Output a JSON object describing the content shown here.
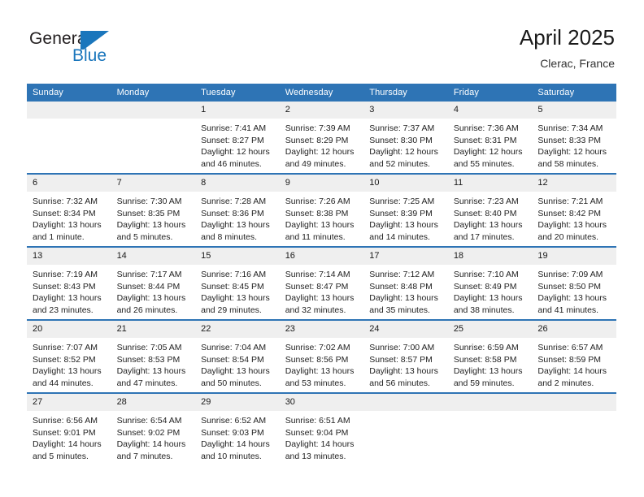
{
  "brand": {
    "name_part1": "General",
    "name_part2": "Blue",
    "logo_icon": "flag-triangle-icon",
    "accent_color": "#1a76bc"
  },
  "header": {
    "title": "April 2025",
    "location": "Clerac, France"
  },
  "theme": {
    "header_blue": "#2e74b5",
    "daynum_background": "#efefef",
    "text_color": "#222222"
  },
  "calendar": {
    "weekday_headers": [
      "Sunday",
      "Monday",
      "Tuesday",
      "Wednesday",
      "Thursday",
      "Friday",
      "Saturday"
    ],
    "weeks": [
      [
        {
          "day": "",
          "blank": true
        },
        {
          "day": "",
          "blank": true
        },
        {
          "day": "1",
          "sunrise": "Sunrise: 7:41 AM",
          "sunset": "Sunset: 8:27 PM",
          "daylight": "Daylight: 12 hours and 46 minutes."
        },
        {
          "day": "2",
          "sunrise": "Sunrise: 7:39 AM",
          "sunset": "Sunset: 8:29 PM",
          "daylight": "Daylight: 12 hours and 49 minutes."
        },
        {
          "day": "3",
          "sunrise": "Sunrise: 7:37 AM",
          "sunset": "Sunset: 8:30 PM",
          "daylight": "Daylight: 12 hours and 52 minutes."
        },
        {
          "day": "4",
          "sunrise": "Sunrise: 7:36 AM",
          "sunset": "Sunset: 8:31 PM",
          "daylight": "Daylight: 12 hours and 55 minutes."
        },
        {
          "day": "5",
          "sunrise": "Sunrise: 7:34 AM",
          "sunset": "Sunset: 8:33 PM",
          "daylight": "Daylight: 12 hours and 58 minutes."
        }
      ],
      [
        {
          "day": "6",
          "sunrise": "Sunrise: 7:32 AM",
          "sunset": "Sunset: 8:34 PM",
          "daylight": "Daylight: 13 hours and 1 minute."
        },
        {
          "day": "7",
          "sunrise": "Sunrise: 7:30 AM",
          "sunset": "Sunset: 8:35 PM",
          "daylight": "Daylight: 13 hours and 5 minutes."
        },
        {
          "day": "8",
          "sunrise": "Sunrise: 7:28 AM",
          "sunset": "Sunset: 8:36 PM",
          "daylight": "Daylight: 13 hours and 8 minutes."
        },
        {
          "day": "9",
          "sunrise": "Sunrise: 7:26 AM",
          "sunset": "Sunset: 8:38 PM",
          "daylight": "Daylight: 13 hours and 11 minutes."
        },
        {
          "day": "10",
          "sunrise": "Sunrise: 7:25 AM",
          "sunset": "Sunset: 8:39 PM",
          "daylight": "Daylight: 13 hours and 14 minutes."
        },
        {
          "day": "11",
          "sunrise": "Sunrise: 7:23 AM",
          "sunset": "Sunset: 8:40 PM",
          "daylight": "Daylight: 13 hours and 17 minutes."
        },
        {
          "day": "12",
          "sunrise": "Sunrise: 7:21 AM",
          "sunset": "Sunset: 8:42 PM",
          "daylight": "Daylight: 13 hours and 20 minutes."
        }
      ],
      [
        {
          "day": "13",
          "sunrise": "Sunrise: 7:19 AM",
          "sunset": "Sunset: 8:43 PM",
          "daylight": "Daylight: 13 hours and 23 minutes."
        },
        {
          "day": "14",
          "sunrise": "Sunrise: 7:17 AM",
          "sunset": "Sunset: 8:44 PM",
          "daylight": "Daylight: 13 hours and 26 minutes."
        },
        {
          "day": "15",
          "sunrise": "Sunrise: 7:16 AM",
          "sunset": "Sunset: 8:45 PM",
          "daylight": "Daylight: 13 hours and 29 minutes."
        },
        {
          "day": "16",
          "sunrise": "Sunrise: 7:14 AM",
          "sunset": "Sunset: 8:47 PM",
          "daylight": "Daylight: 13 hours and 32 minutes."
        },
        {
          "day": "17",
          "sunrise": "Sunrise: 7:12 AM",
          "sunset": "Sunset: 8:48 PM",
          "daylight": "Daylight: 13 hours and 35 minutes."
        },
        {
          "day": "18",
          "sunrise": "Sunrise: 7:10 AM",
          "sunset": "Sunset: 8:49 PM",
          "daylight": "Daylight: 13 hours and 38 minutes."
        },
        {
          "day": "19",
          "sunrise": "Sunrise: 7:09 AM",
          "sunset": "Sunset: 8:50 PM",
          "daylight": "Daylight: 13 hours and 41 minutes."
        }
      ],
      [
        {
          "day": "20",
          "sunrise": "Sunrise: 7:07 AM",
          "sunset": "Sunset: 8:52 PM",
          "daylight": "Daylight: 13 hours and 44 minutes."
        },
        {
          "day": "21",
          "sunrise": "Sunrise: 7:05 AM",
          "sunset": "Sunset: 8:53 PM",
          "daylight": "Daylight: 13 hours and 47 minutes."
        },
        {
          "day": "22",
          "sunrise": "Sunrise: 7:04 AM",
          "sunset": "Sunset: 8:54 PM",
          "daylight": "Daylight: 13 hours and 50 minutes."
        },
        {
          "day": "23",
          "sunrise": "Sunrise: 7:02 AM",
          "sunset": "Sunset: 8:56 PM",
          "daylight": "Daylight: 13 hours and 53 minutes."
        },
        {
          "day": "24",
          "sunrise": "Sunrise: 7:00 AM",
          "sunset": "Sunset: 8:57 PM",
          "daylight": "Daylight: 13 hours and 56 minutes."
        },
        {
          "day": "25",
          "sunrise": "Sunrise: 6:59 AM",
          "sunset": "Sunset: 8:58 PM",
          "daylight": "Daylight: 13 hours and 59 minutes."
        },
        {
          "day": "26",
          "sunrise": "Sunrise: 6:57 AM",
          "sunset": "Sunset: 8:59 PM",
          "daylight": "Daylight: 14 hours and 2 minutes."
        }
      ],
      [
        {
          "day": "27",
          "sunrise": "Sunrise: 6:56 AM",
          "sunset": "Sunset: 9:01 PM",
          "daylight": "Daylight: 14 hours and 5 minutes."
        },
        {
          "day": "28",
          "sunrise": "Sunrise: 6:54 AM",
          "sunset": "Sunset: 9:02 PM",
          "daylight": "Daylight: 14 hours and 7 minutes."
        },
        {
          "day": "29",
          "sunrise": "Sunrise: 6:52 AM",
          "sunset": "Sunset: 9:03 PM",
          "daylight": "Daylight: 14 hours and 10 minutes."
        },
        {
          "day": "30",
          "sunrise": "Sunrise: 6:51 AM",
          "sunset": "Sunset: 9:04 PM",
          "daylight": "Daylight: 14 hours and 13 minutes."
        },
        {
          "day": "",
          "blank": true
        },
        {
          "day": "",
          "blank": true
        },
        {
          "day": "",
          "blank": true
        }
      ]
    ]
  }
}
